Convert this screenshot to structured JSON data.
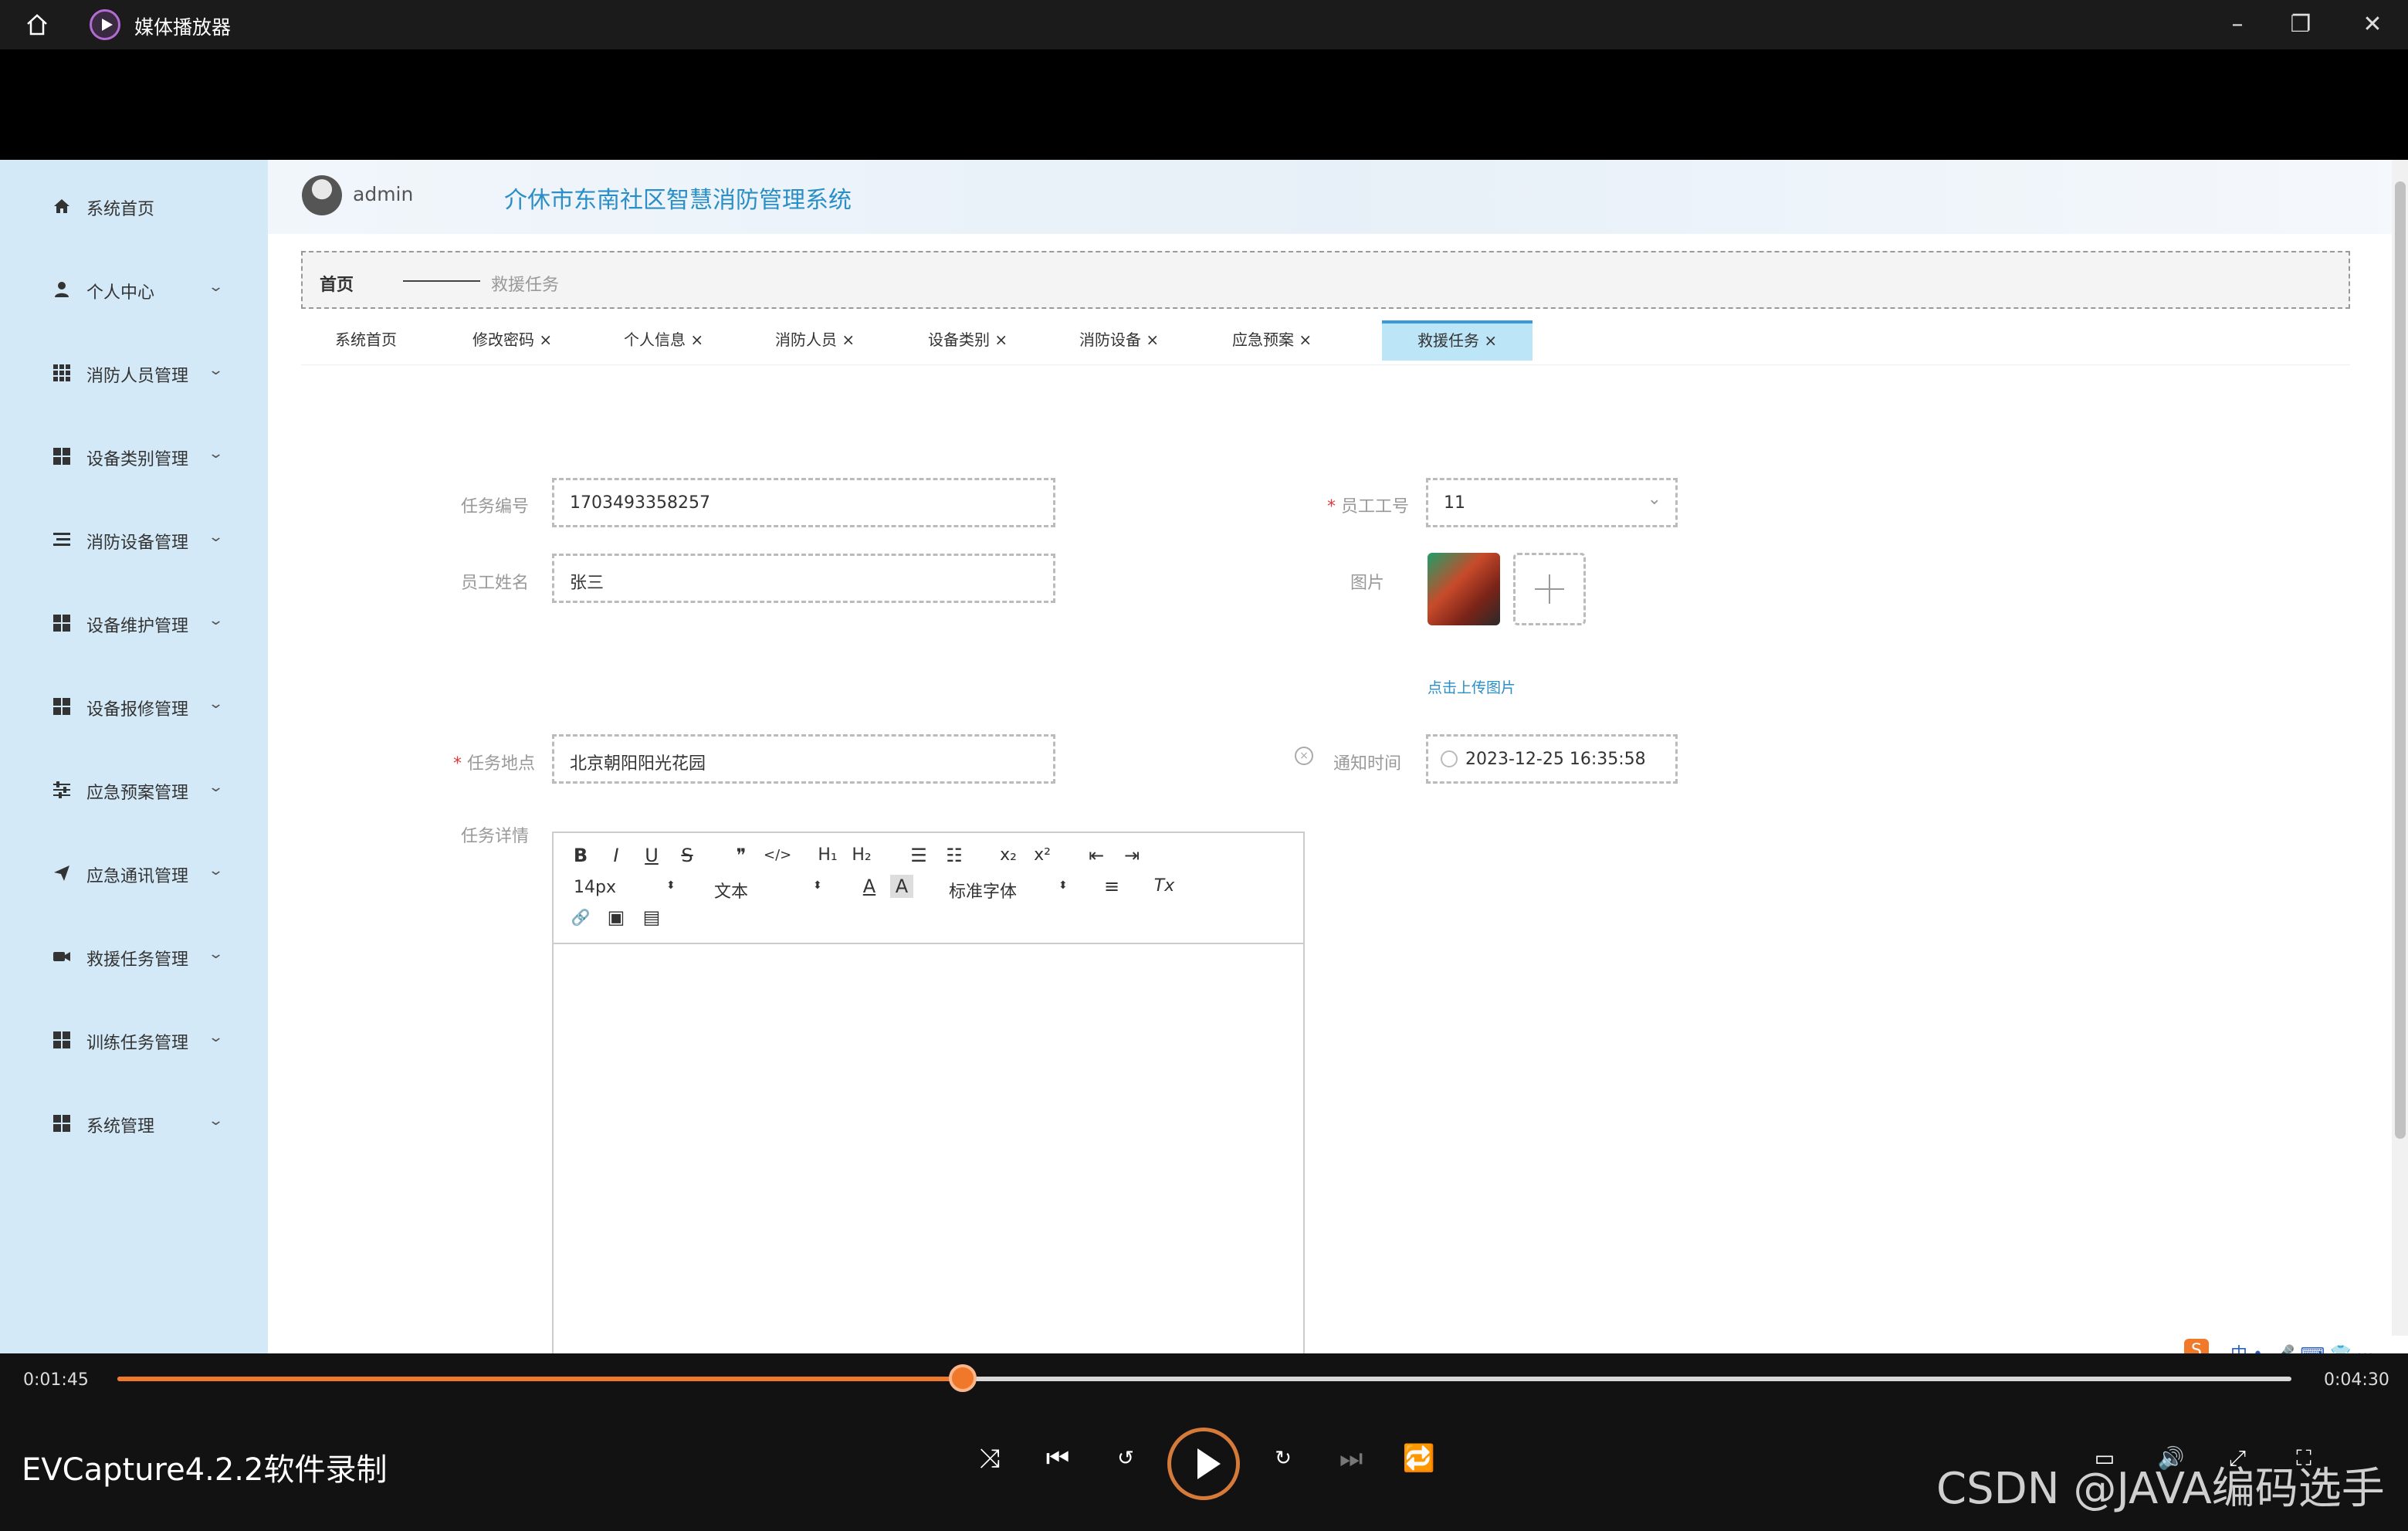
{
  "window": {
    "title": "媒体播放器"
  },
  "app": {
    "username": "admin",
    "system_title": "介休市东南社区智慧消防管理系统"
  },
  "sidebar": {
    "items": [
      {
        "label": "系统首页"
      },
      {
        "label": "个人中心"
      },
      {
        "label": "消防人员管理"
      },
      {
        "label": "设备类别管理"
      },
      {
        "label": "消防设备管理"
      },
      {
        "label": "设备维护管理"
      },
      {
        "label": "设备报修管理"
      },
      {
        "label": "应急预案管理"
      },
      {
        "label": "应急通讯管理"
      },
      {
        "label": "救援任务管理"
      },
      {
        "label": "训练任务管理"
      },
      {
        "label": "系统管理"
      }
    ]
  },
  "breadcrumb": {
    "home": "首页",
    "current": "救援任务"
  },
  "tabs": [
    {
      "label": "系统首页"
    },
    {
      "label": "修改密码 ×"
    },
    {
      "label": "个人信息 ×"
    },
    {
      "label": "消防人员 ×"
    },
    {
      "label": "设备类别 ×"
    },
    {
      "label": "消防设备 ×"
    },
    {
      "label": "应急预案 ×"
    },
    {
      "label": "救援任务 ×"
    }
  ],
  "form": {
    "task_no_label": "任务编号",
    "task_no_value": "1703493358257",
    "emp_no_label": "员工工号",
    "emp_no_value": "11",
    "emp_name_label": "员工姓名",
    "emp_name_value": "张三",
    "image_label": "图片",
    "upload_hint": "点击上传图片",
    "location_label": "任务地点",
    "location_value": "北京朝阳阳光花园",
    "notify_label": "通知时间",
    "notify_value": "2023-12-25 16:35:58",
    "detail_label": "任务详情",
    "required_mark": "*"
  },
  "editor": {
    "font_size": "14px",
    "block_type": "文本",
    "font_family": "标准字体",
    "btn_bold": "B",
    "btn_italic": "I",
    "btn_underline": "U",
    "btn_strike": "S",
    "btn_quote": "❞",
    "btn_code": "</>",
    "btn_h1": "H₁",
    "btn_h2": "H₂",
    "btn_ol": "☰",
    "btn_ul": "☷",
    "btn_sub": "x₂",
    "btn_sup": "x²",
    "btn_outdent": "⇤",
    "btn_indent": "⇥",
    "btn_color": "A",
    "btn_bg": "A",
    "btn_align": "≡",
    "btn_clear": "Tx",
    "btn_link": "🔗",
    "btn_image": "▣",
    "btn_video": "▤"
  },
  "player": {
    "current_time": "0:01:45",
    "total_time": "0:04:30",
    "progress": 0.3889,
    "recorder": "EVCapture4.2.2软件录制",
    "watermark": "CSDN @JAVA编码选手"
  },
  "colors": {
    "sidebar_bg": "#d4e9f7",
    "accent": "#2a8fc6",
    "active_tab": "#bde5f8",
    "seek": "#f0782a",
    "required": "#e4393c"
  },
  "icons": {
    "home": "home-icon",
    "user": "user-icon",
    "grid": "grid-icon",
    "list": "list-icon",
    "sliders": "sliders-icon",
    "send": "send-icon",
    "camera": "camera-icon",
    "chevron": "chevron-down-icon"
  }
}
